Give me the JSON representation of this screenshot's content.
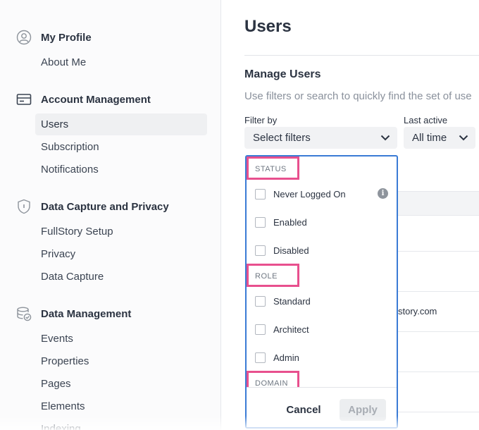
{
  "sidebar": {
    "sections": [
      {
        "label": "My Profile",
        "icon": "user-circle-icon",
        "items": [
          {
            "label": "About Me"
          }
        ]
      },
      {
        "label": "Account Management",
        "icon": "credit-card-icon",
        "items": [
          {
            "label": "Users",
            "active": true
          },
          {
            "label": "Subscription"
          },
          {
            "label": "Notifications"
          }
        ]
      },
      {
        "label": "Data Capture and Privacy",
        "icon": "shield-icon",
        "items": [
          {
            "label": "FullStory Setup"
          },
          {
            "label": "Privacy"
          },
          {
            "label": "Data Capture"
          }
        ]
      },
      {
        "label": "Data Management",
        "icon": "database-check-icon",
        "items": [
          {
            "label": "Events"
          },
          {
            "label": "Properties"
          },
          {
            "label": "Pages"
          },
          {
            "label": "Elements"
          },
          {
            "label": "Indexing"
          }
        ]
      }
    ]
  },
  "main": {
    "title": "Users",
    "subtitle": "Manage Users",
    "description": "Use filters or search to quickly find the set of use",
    "filter_by": {
      "label": "Filter by",
      "value": "Select filters"
    },
    "last_active": {
      "label": "Last active",
      "value": "All time"
    },
    "table_partial_text": "story.com"
  },
  "dropdown": {
    "groups": [
      {
        "label": "STATUS",
        "options": [
          "Never Logged On",
          "Enabled",
          "Disabled"
        ]
      },
      {
        "label": "ROLE",
        "options": [
          "Standard",
          "Architect",
          "Admin"
        ]
      },
      {
        "label": "DOMAIN",
        "options": []
      }
    ],
    "info_glyph": "i",
    "cancel_label": "Cancel",
    "apply_label": "Apply"
  },
  "colors": {
    "focus_border": "#3a7bd5",
    "highlight_box": "#e8508e",
    "sidebar_bg": "#fbfbfc",
    "active_item_bg": "#eff0f2"
  }
}
